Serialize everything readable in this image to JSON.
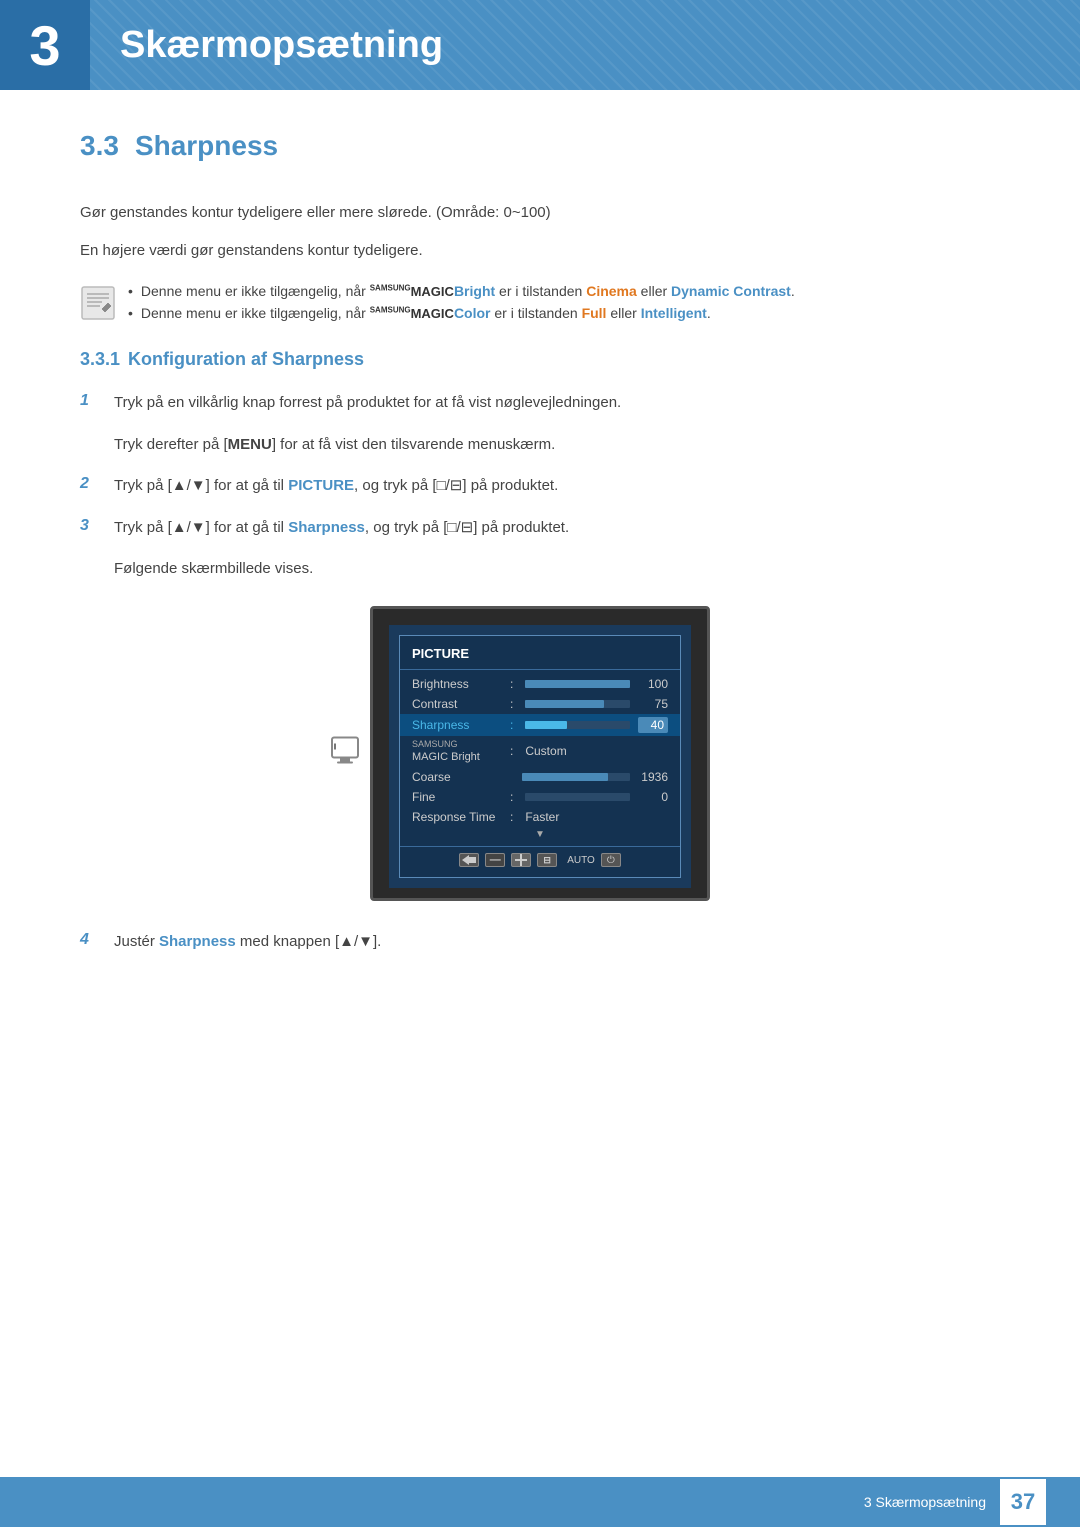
{
  "header": {
    "chapter_number": "3",
    "chapter_title": "Skærmopsætning",
    "background_color": "#4a90c4"
  },
  "section": {
    "number": "3.3",
    "title": "Sharpness",
    "description1": "Gør genstandes kontur tydeligere eller mere slørede. (Område: 0~100)",
    "description2": "En højere værdi gør genstandens kontur tydeligere.",
    "notes": [
      {
        "text_before": "Denne menu er ikke tilgængelig, når ",
        "samsung_magic": "SAMSUNG",
        "magic_word": "Bright",
        "text_middle": " er i tilstanden ",
        "highlight1": "Cinema",
        "text_between": " eller ",
        "highlight2": "Dynamic Contrast",
        "text_after": "."
      },
      {
        "text_before": "Denne menu er ikke tilgængelig, når ",
        "samsung_magic": "SAMSUNG",
        "magic_word": "Color",
        "text_middle": " er i tilstanden ",
        "highlight1": "Full",
        "text_between": " eller ",
        "highlight2": "Intelligent",
        "text_after": "."
      }
    ],
    "subsection": {
      "number": "3.3.1",
      "title": "Konfiguration af Sharpness",
      "steps": [
        {
          "number": "1",
          "text": "Tryk på en vilkårlig knap forrest på produktet for at få vist nøglevejledningen.",
          "sub_text": "Tryk derefter på [MENU] for at få vist den tilsvarende menuskærm."
        },
        {
          "number": "2",
          "text_before": "Tryk på [▲/▼] for at gå til ",
          "highlight": "PICTURE",
          "text_after": ", og tryk på [□/⊟] på produktet."
        },
        {
          "number": "3",
          "text_before": "Tryk på [▲/▼] for at gå til ",
          "highlight": "Sharpness",
          "text_after": ", og tryk på [□/⊟] på produktet.",
          "sub_text": "Følgende skærmbillede vises."
        },
        {
          "number": "4",
          "text_before": "Justér ",
          "highlight": "Sharpness",
          "text_after": " med knappen [▲/▼]."
        }
      ]
    }
  },
  "osd_menu": {
    "title": "PICTURE",
    "items": [
      {
        "label": "Brightness",
        "type": "bar",
        "fill_pct": 100,
        "value": "100",
        "selected": false
      },
      {
        "label": "Contrast",
        "type": "bar",
        "fill_pct": 75,
        "value": "75",
        "selected": false
      },
      {
        "label": "Sharpness",
        "type": "bar",
        "fill_pct": 40,
        "value": "40",
        "selected": true
      },
      {
        "label": "SAMSUNG\nMAGIC Bright",
        "type": "text",
        "text_value": "Custom",
        "selected": false
      },
      {
        "label": "Coarse",
        "type": "bar",
        "fill_pct": 80,
        "value": "1936",
        "selected": false
      },
      {
        "label": "Fine",
        "type": "bar",
        "fill_pct": 0,
        "value": "0",
        "selected": false
      },
      {
        "label": "Response Time",
        "type": "text",
        "text_value": "Faster",
        "selected": false
      }
    ]
  },
  "footer": {
    "text": "3 Skærmopsætning",
    "page": "37"
  }
}
